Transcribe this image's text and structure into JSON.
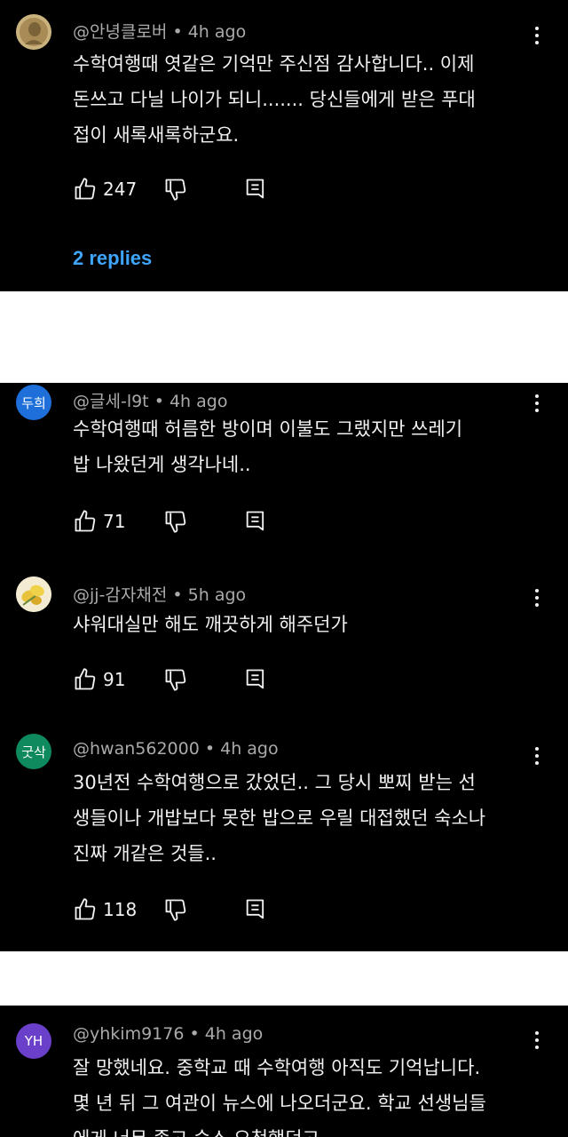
{
  "comments": [
    {
      "handle": "@안녕클로버",
      "time": "4h ago",
      "lines": [
        "수학여행때 엿같은 기억만 주신점 감사합니다.. 이제",
        "돈쓰고 다닐 나이가 되니....... 당신들에게 받은 푸대",
        "접이 새록새록하군요."
      ],
      "likes": "247",
      "replies_label": "2 replies",
      "avatar": {
        "type": "image",
        "icon": "coin-avatar-icon",
        "color": "#b8a070"
      }
    },
    {
      "handle": "@글세-l9t",
      "time": "4h ago",
      "lines": [
        "수학여행때  허름한 방이며 이불도 그랬지만   쓰레기",
        "밥  나왔던게 생각나네.."
      ],
      "likes": "71",
      "avatar": {
        "type": "text",
        "text": "두희",
        "color": "#1e6fd9"
      }
    },
    {
      "handle": "@jj-감자채전",
      "time": "5h ago",
      "lines": [
        "샤워대실만 해도 깨끗하게 해주던가"
      ],
      "likes": "91",
      "avatar": {
        "type": "image",
        "icon": "flower-avatar-icon",
        "color": "#f2e9c8"
      }
    },
    {
      "handle": "@hwan562000",
      "time": "4h ago",
      "lines": [
        "30년전 수학여행으로 갔었던.. 그 당시 뽀찌 받는 선",
        "생들이나 개밥보다 못한 밥으로 우릴 대접했던 숙소나",
        "진짜 개같은 것들.."
      ],
      "likes": "118",
      "avatar": {
        "type": "text",
        "text": "굿삭",
        "color": "#0f8a5f"
      }
    },
    {
      "handle": "@yhkim9176",
      "time": "4h ago",
      "lines": [
        "잘 망했네요. 중학교 때 수학여행 아직도 기억납니다.",
        "몇 년 뒤 그 여관이 뉴스에 나오더군요. 학교 선생님들",
        "에게 너무 좀고 숙소 요청했던고"
      ],
      "avatar": {
        "type": "text",
        "text": "YH",
        "color": "#6a3fc9"
      }
    }
  ],
  "meta_separator": "•",
  "icons": {
    "like": "thumbs-up-icon",
    "dislike": "thumbs-down-icon",
    "reply": "reply-comment-icon",
    "more": "more-vertical-icon"
  },
  "colors": {
    "background": "#000000",
    "text": "#f1f1f1",
    "meta": "#aaaaaa",
    "link": "#3ea6ff",
    "gap": "#ffffff"
  }
}
